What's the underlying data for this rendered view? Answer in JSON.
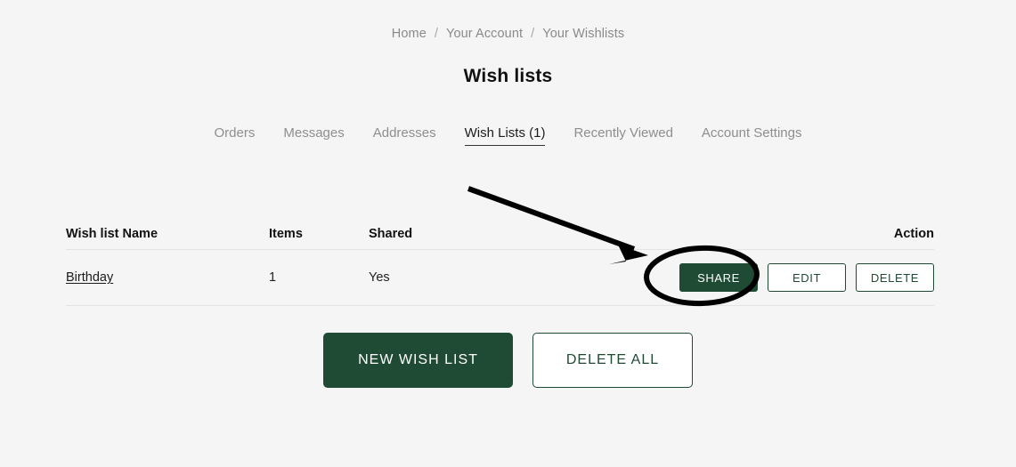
{
  "breadcrumb": {
    "items": [
      "Home",
      "Your Account",
      "Your Wishlists"
    ],
    "separator": "/"
  },
  "page_title": "Wish lists",
  "tabs": [
    {
      "label": "Orders",
      "active": false
    },
    {
      "label": "Messages",
      "active": false
    },
    {
      "label": "Addresses",
      "active": false
    },
    {
      "label": "Wish Lists (1)",
      "active": true
    },
    {
      "label": "Recently Viewed",
      "active": false
    },
    {
      "label": "Account Settings",
      "active": false
    }
  ],
  "table": {
    "headers": {
      "name": "Wish list Name",
      "items": "Items",
      "shared": "Shared",
      "action": "Action"
    },
    "rows": [
      {
        "name": "Birthday",
        "items": "1",
        "shared": "Yes",
        "actions": [
          "SHARE",
          "EDIT",
          "DELETE"
        ]
      }
    ]
  },
  "row_actions": {
    "share": "SHARE",
    "edit": "EDIT",
    "delete": "DELETE"
  },
  "bottom_actions": {
    "new_wish_list": "NEW WISH LIST",
    "delete_all": "DELETE ALL"
  },
  "colors": {
    "background": "#f4f5f4",
    "brand_green": "#1f4a33",
    "muted_text": "#8e8e8e",
    "divider": "#e3e4e3",
    "annotation": "#000000"
  },
  "annotations": {
    "arrow": "arrow pointing to SHARE button",
    "ellipse": "ellipse highlighting SHARE button"
  }
}
